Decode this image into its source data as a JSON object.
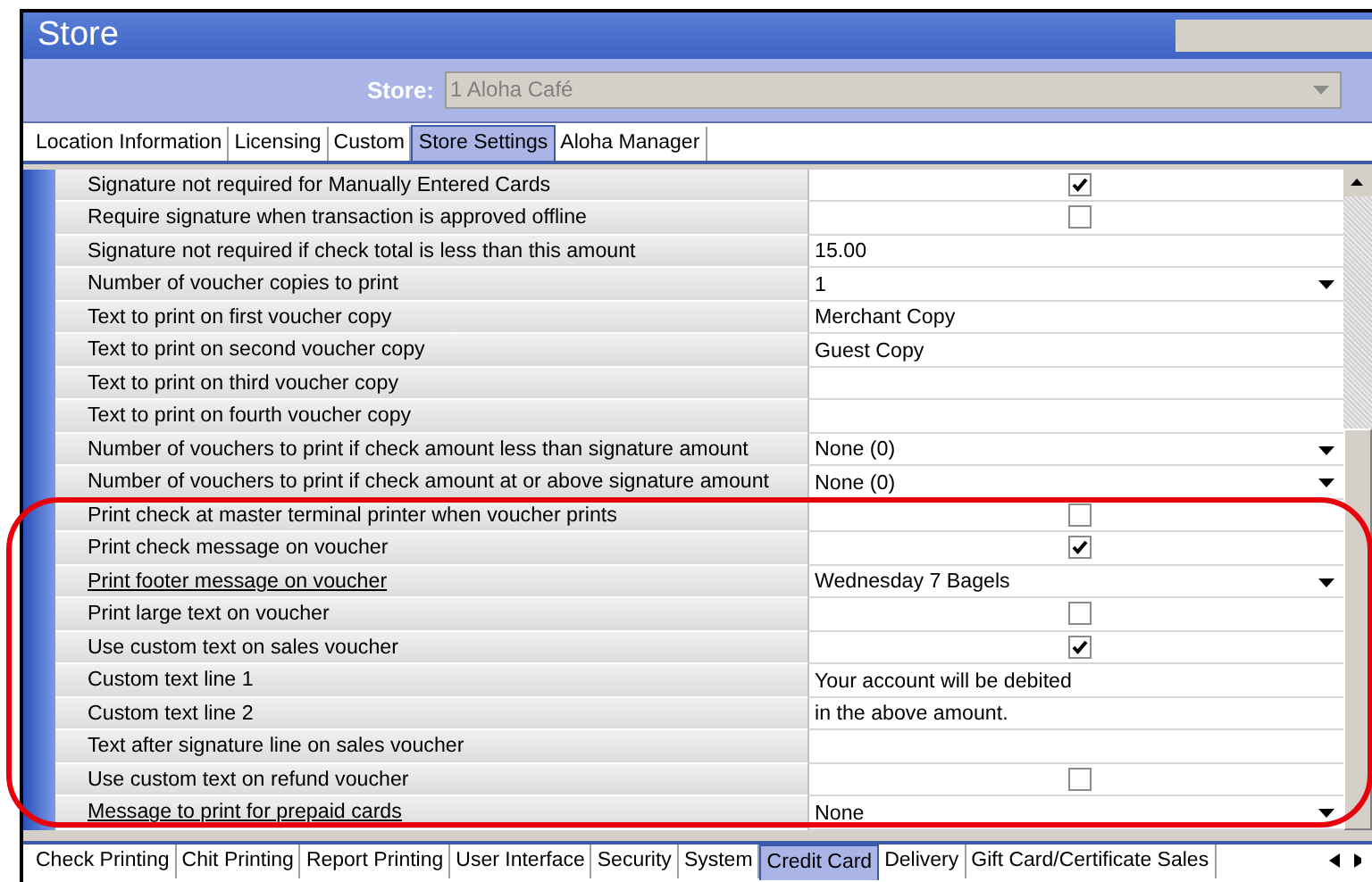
{
  "window": {
    "title": "Store"
  },
  "store": {
    "label": "Store:",
    "value": "1 Aloha Café"
  },
  "top_tabs": [
    {
      "label": "Location Information",
      "selected": false
    },
    {
      "label": "Licensing",
      "selected": false
    },
    {
      "label": "Custom",
      "selected": false
    },
    {
      "label": "Store Settings",
      "selected": true
    },
    {
      "label": "Aloha Manager",
      "selected": false
    }
  ],
  "rows": [
    {
      "label": "Signature not required for Manually Entered Cards",
      "underlined": false,
      "kind": "checkbox",
      "checked": true
    },
    {
      "label": "Require signature when transaction is approved offline",
      "underlined": false,
      "kind": "checkbox",
      "checked": false
    },
    {
      "label": "Signature not required if check total is less than this amount",
      "underlined": false,
      "kind": "text",
      "value": "15.00"
    },
    {
      "label": "Number of voucher copies to print",
      "underlined": false,
      "kind": "dropdown",
      "value": "1"
    },
    {
      "label": "Text to print on first voucher copy",
      "underlined": false,
      "kind": "text",
      "value": "Merchant Copy"
    },
    {
      "label": "Text to print on second voucher copy",
      "underlined": false,
      "kind": "text",
      "value": "Guest Copy"
    },
    {
      "label": "Text to print on third voucher copy",
      "underlined": false,
      "kind": "text"
    },
    {
      "label": "Text to print on fourth voucher copy",
      "underlined": false,
      "kind": "text"
    },
    {
      "label": "Number of vouchers to print if check amount less than signature amount",
      "underlined": false,
      "kind": "dropdown",
      "value": "None (0)"
    },
    {
      "label": "Number of vouchers to print if check amount at or above signature amount",
      "underlined": false,
      "kind": "dropdown",
      "value": "None (0)"
    },
    {
      "label": "Print check at master terminal printer when voucher prints",
      "underlined": false,
      "kind": "checkbox",
      "checked": false
    },
    {
      "label": "Print check message on voucher",
      "underlined": false,
      "kind": "checkbox",
      "checked": true
    },
    {
      "label": "Print footer message on voucher",
      "underlined": true,
      "kind": "dropdown",
      "value": "Wednesday 7 Bagels"
    },
    {
      "label": "Print large text on voucher",
      "underlined": false,
      "kind": "checkbox",
      "checked": false
    },
    {
      "label": "Use custom text on sales voucher",
      "underlined": false,
      "kind": "checkbox",
      "checked": true
    },
    {
      "label": "Custom text line 1",
      "underlined": false,
      "kind": "text",
      "value": "Your account will be debited"
    },
    {
      "label": "Custom text line 2",
      "underlined": false,
      "kind": "text",
      "value": "in the above amount."
    },
    {
      "label": "Text after signature line on sales voucher",
      "underlined": false,
      "kind": "text"
    },
    {
      "label": "Use custom text on refund voucher",
      "underlined": false,
      "kind": "checkbox",
      "checked": false
    },
    {
      "label": "Message to print for prepaid cards",
      "underlined": true,
      "kind": "dropdown",
      "value": "None"
    }
  ],
  "bottom_tabs": [
    {
      "label": "Check Printing",
      "selected": false
    },
    {
      "label": "Chit Printing",
      "selected": false
    },
    {
      "label": "Report Printing",
      "selected": false
    },
    {
      "label": "User Interface",
      "selected": false
    },
    {
      "label": "Security",
      "selected": false
    },
    {
      "label": "System",
      "selected": false
    },
    {
      "label": "Credit Card",
      "selected": true
    },
    {
      "label": "Delivery",
      "selected": false
    },
    {
      "label": "Gift Card/Certificate Sales",
      "selected": false
    }
  ]
}
